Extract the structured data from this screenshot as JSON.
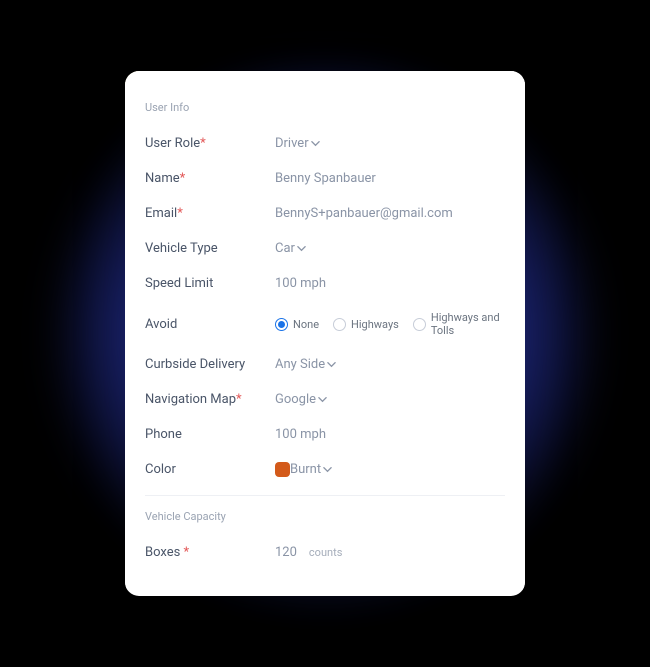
{
  "sections": {
    "user_info_title": "User Info",
    "vehicle_capacity_title": "Vehicle Capacity"
  },
  "fields": {
    "user_role": {
      "label": "User Role",
      "required": true,
      "value": "Driver"
    },
    "name": {
      "label": "Name",
      "required": true,
      "value": "Benny Spanbauer"
    },
    "email": {
      "label": "Email",
      "required": true,
      "value": "BennyS+panbauer@gmail.com"
    },
    "vehicle_type": {
      "label": "Vehicle Type",
      "required": false,
      "value": "Car"
    },
    "speed_limit": {
      "label": "Speed Limit",
      "required": false,
      "value": "100 mph"
    },
    "avoid": {
      "label": "Avoid",
      "required": false,
      "options": [
        {
          "label": "None",
          "selected": true
        },
        {
          "label": "Highways",
          "selected": false
        },
        {
          "label": "Highways and Tolls",
          "selected": false
        }
      ]
    },
    "curbside_delivery": {
      "label": "Curbside Delivery",
      "required": false,
      "value": "Any Side"
    },
    "navigation_map": {
      "label": "Navigation Map",
      "required": true,
      "value": "Google"
    },
    "phone": {
      "label": "Phone",
      "required": false,
      "value": "100 mph"
    },
    "color": {
      "label": "Color",
      "required": false,
      "value": "Burnt",
      "swatch": "#d35a1a"
    },
    "boxes": {
      "label": "Boxes",
      "required": true,
      "value": "120",
      "units": "counts"
    }
  }
}
